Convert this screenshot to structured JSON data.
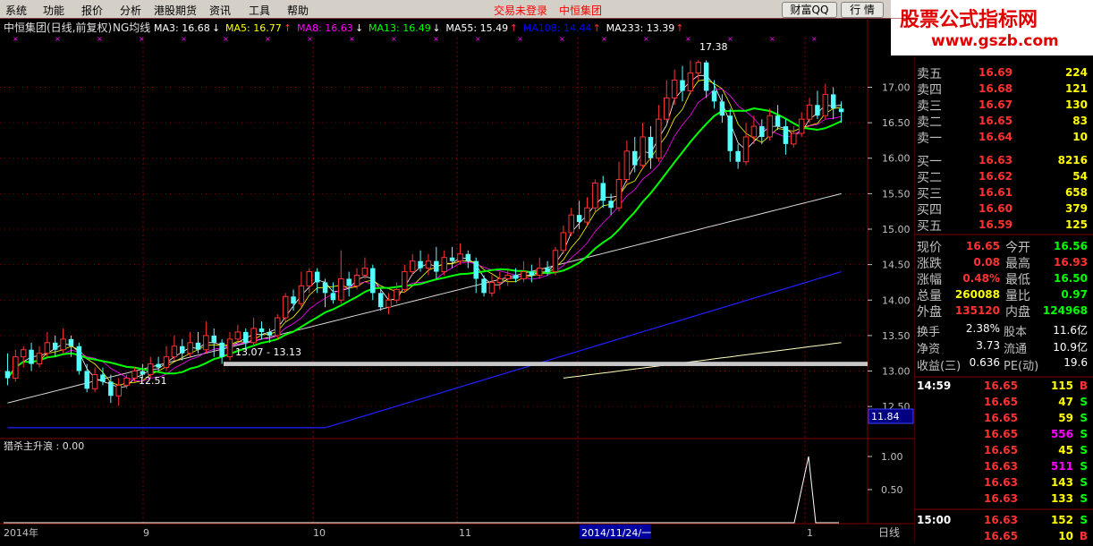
{
  "menu": {
    "items": [
      "系统",
      "功能",
      "报价",
      "分析",
      "港股期货",
      "资讯",
      "工具",
      "帮助"
    ],
    "status_login": "交易未登录",
    "status_name": "中恒集团",
    "buttons": [
      "财富QQ",
      "行 情"
    ]
  },
  "brand": {
    "title": "股票公式指标网",
    "url": "www.gszb.com"
  },
  "chart_header": {
    "title": "中恒集团(日线,前复权)",
    "indicator": "NG均线",
    "mas": [
      {
        "label": "MA3: 16.68",
        "arrow": "↓",
        "color": "#ffffff"
      },
      {
        "label": "MA5: 16.77",
        "arrow": "↑",
        "color": "#ffff00"
      },
      {
        "label": "MA8: 16.63",
        "arrow": "↓",
        "color": "#ff00ff"
      },
      {
        "label": "MA13: 16.49",
        "arrow": "↓",
        "color": "#00ff00"
      },
      {
        "label": "MA55: 15.49",
        "arrow": "↑",
        "color": "#ffffff"
      },
      {
        "label": "MA108: 14.44",
        "arrow": "↑",
        "color": "#0000ff"
      },
      {
        "label": "MA233: 13.39",
        "arrow": "↑",
        "color": "#ffffff"
      }
    ]
  },
  "lower_panel": {
    "title": "猎杀主升浪 : 0.00",
    "yticks": [
      "1.00",
      "0.50"
    ]
  },
  "x_axis": {
    "labels": [
      "2014年",
      "9",
      "10",
      "11",
      "2014/11/24/一",
      "1"
    ],
    "period": "日线"
  },
  "annotations": {
    "high": "17.38",
    "low": "12.51",
    "range": "13.07 - 13.13",
    "axis_mark": "11.84"
  },
  "chart_data": {
    "type": "candlestick",
    "y_ticks": [
      "17.00",
      "16.50",
      "16.00",
      "15.50",
      "15.00",
      "14.50",
      "14.00",
      "13.50",
      "13.00",
      "12.50"
    ],
    "ylim": [
      12.3,
      17.7
    ],
    "candles": [
      [
        13.0,
        12.9,
        13.25,
        12.8
      ],
      [
        12.9,
        13.2,
        13.3,
        12.85
      ],
      [
        13.2,
        13.3,
        13.35,
        13.05
      ],
      [
        13.3,
        13.1,
        13.4,
        13.0
      ],
      [
        13.1,
        13.25,
        13.35,
        13.05
      ],
      [
        13.25,
        13.4,
        13.55,
        13.2
      ],
      [
        13.4,
        13.3,
        13.5,
        13.2
      ],
      [
        13.3,
        13.45,
        13.6,
        13.25
      ],
      [
        13.45,
        13.35,
        13.5,
        13.2
      ],
      [
        13.35,
        13.0,
        13.4,
        12.95
      ],
      [
        13.0,
        12.75,
        13.1,
        12.7
      ],
      [
        12.75,
        12.95,
        13.05,
        12.7
      ],
      [
        12.95,
        12.85,
        13.05,
        12.8
      ],
      [
        12.85,
        12.65,
        12.95,
        12.55
      ],
      [
        12.65,
        12.8,
        12.9,
        12.51
      ],
      [
        12.8,
        12.9,
        12.95,
        12.75
      ],
      [
        12.9,
        13.0,
        13.05,
        12.85
      ],
      [
        13.0,
        12.95,
        13.1,
        12.9
      ],
      [
        12.95,
        13.1,
        13.2,
        12.9
      ],
      [
        13.1,
        13.05,
        13.2,
        13.0
      ],
      [
        13.05,
        13.2,
        13.35,
        13.0
      ],
      [
        13.2,
        13.35,
        13.5,
        13.15
      ],
      [
        13.35,
        13.25,
        13.45,
        13.15
      ],
      [
        13.25,
        13.4,
        13.55,
        13.2
      ],
      [
        13.4,
        13.3,
        13.55,
        13.25
      ],
      [
        13.3,
        13.5,
        13.7,
        13.25
      ],
      [
        13.5,
        13.4,
        13.6,
        13.2
      ],
      [
        13.4,
        13.2,
        13.45,
        13.1
      ],
      [
        13.2,
        13.45,
        13.55,
        13.15
      ],
      [
        13.45,
        13.55,
        13.65,
        13.4
      ],
      [
        13.55,
        13.4,
        13.6,
        13.3
      ],
      [
        13.4,
        13.6,
        13.75,
        13.35
      ],
      [
        13.6,
        13.55,
        13.7,
        13.45
      ],
      [
        13.55,
        13.5,
        13.6,
        13.4
      ],
      [
        13.5,
        13.75,
        13.8,
        13.45
      ],
      [
        13.75,
        14.05,
        14.1,
        13.7
      ],
      [
        14.05,
        13.95,
        14.15,
        13.85
      ],
      [
        13.95,
        14.2,
        14.4,
        13.9
      ],
      [
        14.2,
        14.4,
        14.45,
        14.1
      ],
      [
        14.4,
        14.25,
        14.45,
        14.1
      ],
      [
        14.25,
        14.1,
        14.3,
        13.9
      ],
      [
        14.1,
        14.0,
        14.25,
        13.95
      ],
      [
        14.0,
        14.3,
        14.7,
        13.95
      ],
      [
        14.3,
        14.2,
        14.4,
        14.05
      ],
      [
        14.2,
        14.35,
        14.45,
        14.15
      ],
      [
        14.35,
        14.45,
        14.6,
        14.3
      ],
      [
        14.45,
        14.1,
        14.5,
        14.0
      ],
      [
        14.1,
        13.9,
        14.15,
        13.85
      ],
      [
        13.9,
        14.0,
        14.1,
        13.8
      ],
      [
        14.0,
        14.15,
        14.25,
        13.95
      ],
      [
        14.15,
        14.4,
        14.5,
        14.1
      ],
      [
        14.4,
        14.55,
        14.65,
        14.35
      ],
      [
        14.55,
        14.45,
        14.7,
        14.4
      ],
      [
        14.45,
        14.55,
        14.65,
        14.35
      ],
      [
        14.55,
        14.4,
        14.75,
        14.3
      ],
      [
        14.4,
        14.6,
        14.7,
        14.35
      ],
      [
        14.6,
        14.55,
        14.75,
        14.45
      ],
      [
        14.55,
        14.65,
        14.8,
        14.5
      ],
      [
        14.65,
        14.55,
        14.7,
        14.45
      ],
      [
        14.55,
        14.3,
        14.6,
        14.1
      ],
      [
        14.3,
        14.1,
        14.35,
        14.05
      ],
      [
        14.1,
        14.25,
        14.35,
        14.05
      ],
      [
        14.25,
        14.3,
        14.4,
        14.15
      ],
      [
        14.3,
        14.35,
        14.45,
        14.2
      ],
      [
        14.35,
        14.3,
        14.45,
        14.25
      ],
      [
        14.3,
        14.4,
        14.55,
        14.25
      ],
      [
        14.4,
        14.35,
        14.5,
        14.25
      ],
      [
        14.35,
        14.45,
        14.6,
        14.3
      ],
      [
        14.45,
        14.4,
        14.55,
        14.35
      ],
      [
        14.4,
        14.7,
        14.75,
        14.35
      ],
      [
        14.7,
        14.95,
        15.05,
        14.65
      ],
      [
        14.95,
        15.2,
        15.3,
        14.9
      ],
      [
        15.2,
        15.1,
        15.4,
        15.0
      ],
      [
        15.1,
        15.3,
        15.45,
        15.05
      ],
      [
        15.3,
        15.65,
        15.7,
        15.25
      ],
      [
        15.65,
        15.4,
        15.75,
        15.3
      ],
      [
        15.4,
        15.3,
        15.5,
        15.2
      ],
      [
        15.3,
        15.7,
        15.95,
        15.25
      ],
      [
        15.7,
        16.1,
        16.25,
        15.65
      ],
      [
        16.1,
        15.9,
        16.3,
        15.8
      ],
      [
        15.9,
        16.3,
        16.5,
        15.85
      ],
      [
        16.3,
        16.0,
        16.45,
        15.85
      ],
      [
        16.0,
        16.55,
        16.75,
        15.95
      ],
      [
        16.55,
        16.85,
        17.1,
        16.5
      ],
      [
        16.85,
        17.1,
        17.25,
        16.75
      ],
      [
        17.1,
        16.95,
        17.3,
        16.8
      ],
      [
        16.95,
        17.2,
        17.38,
        16.9
      ],
      [
        17.2,
        17.35,
        17.38,
        17.1
      ],
      [
        17.35,
        16.95,
        17.38,
        16.85
      ],
      [
        16.95,
        16.8,
        17.1,
        16.7
      ],
      [
        16.8,
        16.6,
        16.9,
        16.5
      ],
      [
        16.6,
        16.1,
        16.7,
        15.95
      ],
      [
        16.1,
        15.95,
        16.2,
        15.85
      ],
      [
        15.95,
        16.3,
        16.5,
        15.9
      ],
      [
        16.3,
        16.45,
        16.6,
        16.2
      ],
      [
        16.45,
        16.3,
        16.55,
        16.2
      ],
      [
        16.3,
        16.6,
        16.7,
        16.25
      ],
      [
        16.6,
        16.45,
        16.75,
        16.4
      ],
      [
        16.45,
        16.2,
        16.55,
        16.05
      ],
      [
        16.2,
        16.35,
        16.45,
        16.15
      ],
      [
        16.35,
        16.55,
        16.65,
        16.3
      ],
      [
        16.55,
        16.75,
        16.85,
        16.5
      ],
      [
        16.75,
        16.6,
        16.95,
        16.55
      ],
      [
        16.6,
        16.9,
        17.05,
        16.55
      ],
      [
        16.9,
        16.7,
        17.0,
        16.55
      ],
      [
        16.7,
        16.65,
        16.8,
        16.5
      ]
    ]
  },
  "quotes": {
    "sell": [
      {
        "label": "卖五",
        "price": "16.69",
        "vol": "224"
      },
      {
        "label": "卖四",
        "price": "16.68",
        "vol": "121"
      },
      {
        "label": "卖三",
        "price": "16.67",
        "vol": "130"
      },
      {
        "label": "卖二",
        "price": "16.65",
        "vol": "83"
      },
      {
        "label": "卖一",
        "price": "16.64",
        "vol": "10"
      }
    ],
    "buy": [
      {
        "label": "买一",
        "price": "16.63",
        "vol": "8216"
      },
      {
        "label": "买二",
        "price": "16.62",
        "vol": "54"
      },
      {
        "label": "买三",
        "price": "16.61",
        "vol": "658"
      },
      {
        "label": "买四",
        "price": "16.60",
        "vol": "379"
      },
      {
        "label": "买五",
        "price": "16.59",
        "vol": "125"
      }
    ]
  },
  "stats": [
    {
      "l1": "现价",
      "v1": "16.65",
      "c1": "#ff3232",
      "l2": "今开",
      "v2": "16.56",
      "c2": "#00ff00"
    },
    {
      "l1": "涨跌",
      "v1": "0.08",
      "c1": "#ff3232",
      "l2": "最高",
      "v2": "16.93",
      "c2": "#ff3232"
    },
    {
      "l1": "涨幅",
      "v1": "0.48%",
      "c1": "#ff3232",
      "l2": "最低",
      "v2": "16.50",
      "c2": "#00ff00"
    },
    {
      "l1": "总量",
      "v1": "260088",
      "c1": "#ffff00",
      "l2": "量比",
      "v2": "0.97",
      "c2": "#00ff00"
    },
    {
      "l1": "外盘",
      "v1": "135120",
      "c1": "#ff3232",
      "l2": "内盘",
      "v2": "124968",
      "c2": "#00ff00"
    }
  ],
  "stats2": [
    {
      "l1": "换手",
      "v1": "2.38%",
      "l2": "股本",
      "v2": "11.6亿"
    },
    {
      "l1": "净资",
      "v1": "3.73",
      "l2": "流通",
      "v2": "10.9亿"
    },
    {
      "l1": "收益(三)",
      "v1": "0.636",
      "l2": "PE(动)",
      "v2": "19.6"
    }
  ],
  "ticks": [
    {
      "time": "14:59",
      "price": "16.65",
      "vol": "115",
      "side": "B",
      "vcolor": "#ffff00"
    },
    {
      "time": "",
      "price": "16.65",
      "vol": "47",
      "side": "S",
      "vcolor": "#ffff00"
    },
    {
      "time": "",
      "price": "16.65",
      "vol": "59",
      "side": "S",
      "vcolor": "#ffff00"
    },
    {
      "time": "",
      "price": "16.65",
      "vol": "556",
      "side": "S",
      "vcolor": "#ff00ff"
    },
    {
      "time": "",
      "price": "16.65",
      "vol": "45",
      "side": "S",
      "vcolor": "#ffff00"
    },
    {
      "time": "",
      "price": "16.63",
      "vol": "511",
      "side": "S",
      "vcolor": "#ff00ff"
    },
    {
      "time": "",
      "price": "16.63",
      "vol": "143",
      "side": "S",
      "vcolor": "#ffff00"
    },
    {
      "time": "",
      "price": "16.63",
      "vol": "133",
      "side": "S",
      "vcolor": "#ffff00"
    },
    {
      "time": "15:00",
      "price": "16.63",
      "vol": "152",
      "side": "S",
      "vcolor": "#ffff00"
    },
    {
      "time": "",
      "price": "16.65",
      "vol": "10",
      "side": "B",
      "vcolor": "#ffff00"
    }
  ],
  "colors": {
    "up": "#ff3232",
    "down": "#54ffff",
    "grid": "#800000",
    "ma3": "#ffffff",
    "ma5": "#ffff00",
    "ma8": "#ff00ff",
    "ma13": "#00ff00",
    "ma55": "#dcdcdc",
    "ma108": "#2020ff",
    "ma233": "#ffffc0"
  }
}
